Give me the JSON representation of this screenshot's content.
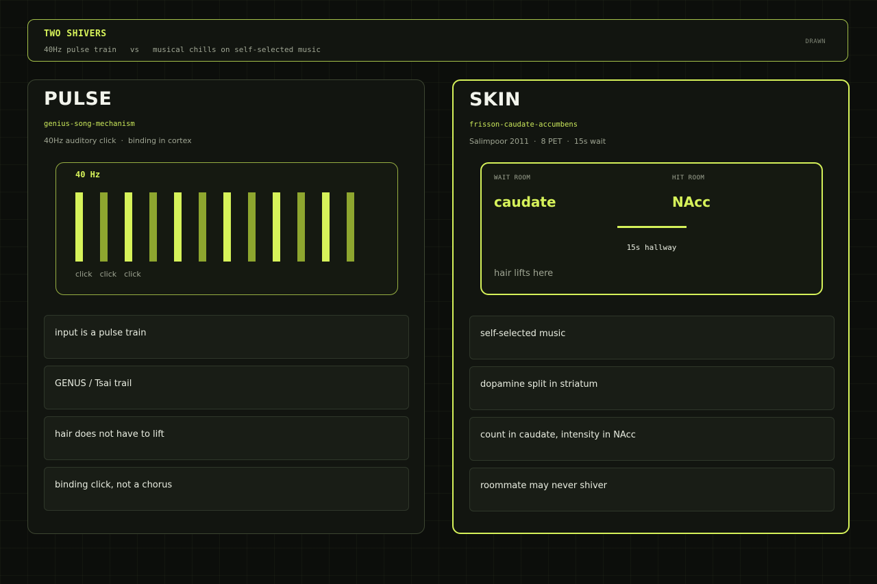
{
  "header": {
    "title": "TWO SHIVERS",
    "subtitle_a": "40Hz pulse train",
    "subtitle_vs": "vs",
    "subtitle_b": "musical chills on self-selected music",
    "tag": "DRAWN"
  },
  "pulse": {
    "title": "PULSE",
    "slug": "genius-song-mechanism",
    "meta_a": "40Hz auditory click",
    "meta_sep": "·",
    "meta_b": "binding in cortex",
    "freq_label": "40 Hz",
    "bar_count": 12,
    "colors": {
      "bright": "#d6f25a",
      "dim": "#8ea62f"
    },
    "clicks": [
      "click",
      "click",
      "click"
    ],
    "cards": [
      "input is a pulse train",
      "GENUS / Tsai trail",
      "hair does not have to lift",
      "binding click, not a chorus"
    ]
  },
  "skin": {
    "title": "SKIN",
    "slug": "frisson-caudate-accumbens",
    "meta_a": "Salimpoor 2011",
    "meta_sep1": "·",
    "meta_b": "8 PET",
    "meta_sep2": "·",
    "meta_c": "15s wait",
    "wait_label": "WAIT ROOM",
    "wait_room": "caudate",
    "hit_label": "HIT ROOM",
    "hit_room": "NAcc",
    "hallway": "15s hallway",
    "note": "hair lifts here",
    "cards": [
      "self-selected music",
      "dopamine split in striatum",
      "count in caudate, intensity in NAcc",
      "roommate may never shiver"
    ]
  }
}
